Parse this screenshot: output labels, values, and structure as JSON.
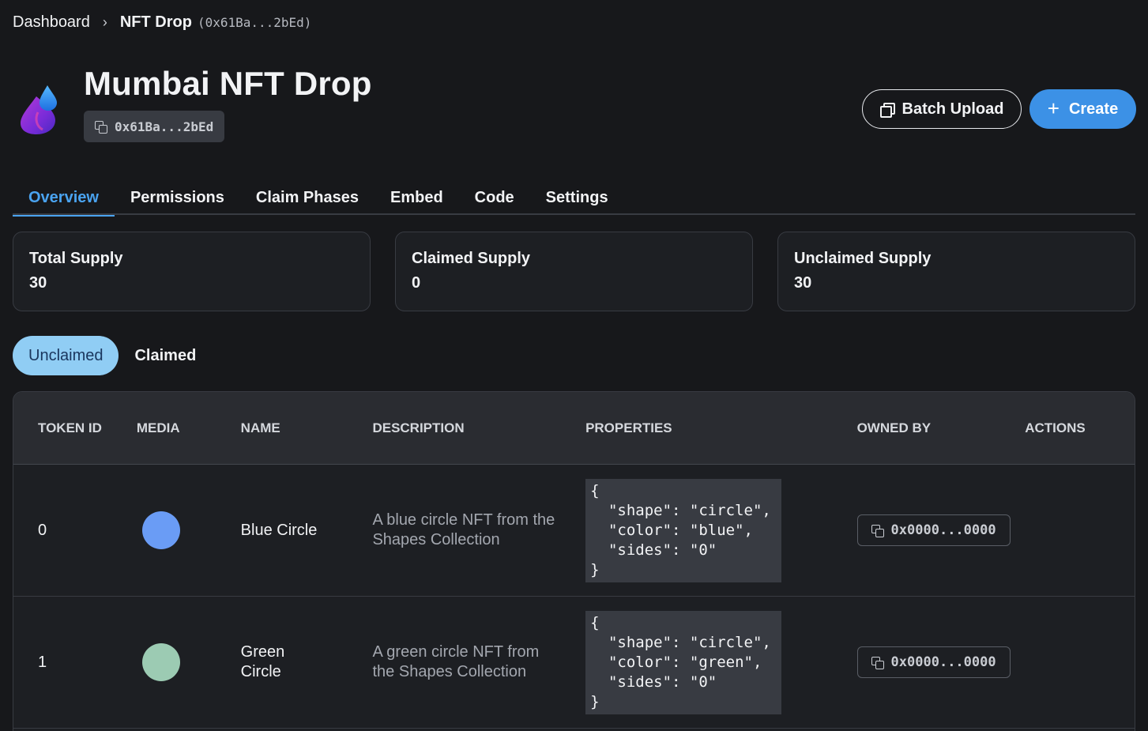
{
  "breadcrumb": {
    "root": "Dashboard",
    "separator": "›",
    "current": "NFT Drop",
    "address": "(0x61Ba...2bEd)"
  },
  "header": {
    "title": "Mumbai NFT Drop",
    "address": "0x61Ba...2bEd",
    "batch_upload_label": "Batch Upload",
    "create_label": "Create",
    "create_icon": "+"
  },
  "tabs": [
    {
      "label": "Overview",
      "active": true
    },
    {
      "label": "Permissions",
      "active": false
    },
    {
      "label": "Claim Phases",
      "active": false
    },
    {
      "label": "Embed",
      "active": false
    },
    {
      "label": "Code",
      "active": false
    },
    {
      "label": "Settings",
      "active": false
    }
  ],
  "stats": [
    {
      "label": "Total Supply",
      "value": "30"
    },
    {
      "label": "Claimed Supply",
      "value": "0"
    },
    {
      "label": "Unclaimed Supply",
      "value": "30"
    }
  ],
  "claim_filter": {
    "unclaimed_label": "Unclaimed",
    "claimed_label": "Claimed",
    "active": "Unclaimed"
  },
  "table": {
    "headers": {
      "token_id": "TOKEN ID",
      "media": "MEDIA",
      "name": "NAME",
      "description": "DESCRIPTION",
      "properties": "PROPERTIES",
      "owned_by": "OWNED BY",
      "actions": "ACTIONS"
    },
    "rows": [
      {
        "token_id": "0",
        "media_color": "#6a9cf5",
        "name": "Blue Circle",
        "description": "A blue circle NFT from the Shapes Collection",
        "properties": "{\n  \"shape\": \"circle\",\n  \"color\": \"blue\",\n  \"sides\": \"0\"\n}",
        "owned_by": "0x0000...0000"
      },
      {
        "token_id": "1",
        "media_color": "#9ccbb3",
        "name": "Green Circle",
        "description": "A green circle NFT from the Shapes Collection",
        "properties": "{\n  \"shape\": \"circle\",\n  \"color\": \"green\",\n  \"sides\": \"0\"\n}",
        "owned_by": "0x0000...0000"
      }
    ]
  },
  "colors": {
    "background": "#17181b",
    "accent": "#3c91e6",
    "active_tab": "#4aa3f0",
    "pill_active": "#90cdf4"
  }
}
